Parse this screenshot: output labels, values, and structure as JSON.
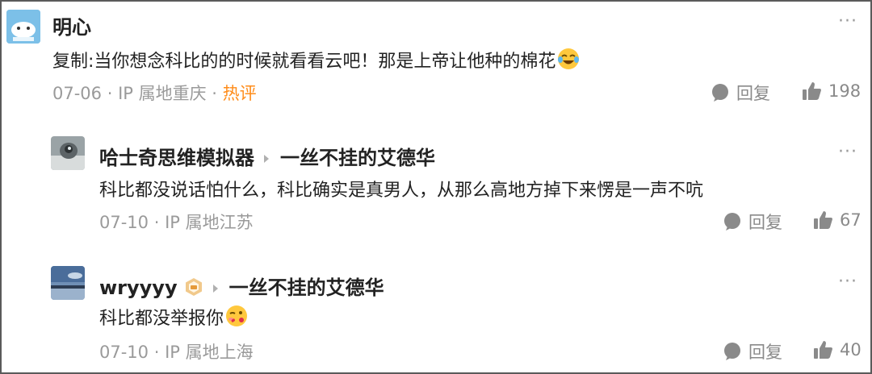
{
  "comments": [
    {
      "author": "明心",
      "text": "复制:当你想念科比的的时候就看看云吧！那是上帝让他种的棉花",
      "emoji_icon": "laughing-crying-emoji-icon",
      "date": "07-06",
      "location": "IP 属地重庆",
      "tag": "热评",
      "reply_label": "回复",
      "likes": "198"
    },
    {
      "author": "哈士奇思维模拟器",
      "reply_to": "一丝不挂的艾德华",
      "text": "科比都没说话怕什么，科比确实是真男人，从那么高地方掉下来愣是一声不吭",
      "date": "07-10",
      "location": "IP 属地江苏",
      "reply_label": "回复",
      "likes": "67"
    },
    {
      "author": "wryyyy",
      "reply_to": "一丝不挂的艾德华",
      "text": "科比都没举报你",
      "emoji_icon": "wink-kiss-emoji-icon",
      "date": "07-10",
      "location": "IP 属地上海",
      "reply_label": "回复",
      "likes": "40"
    }
  ],
  "separator": " · ",
  "more_label": "···",
  "colors": {
    "hot_tag": "#ff8c1a",
    "meta": "#9a9a9a",
    "text": "#222222"
  }
}
